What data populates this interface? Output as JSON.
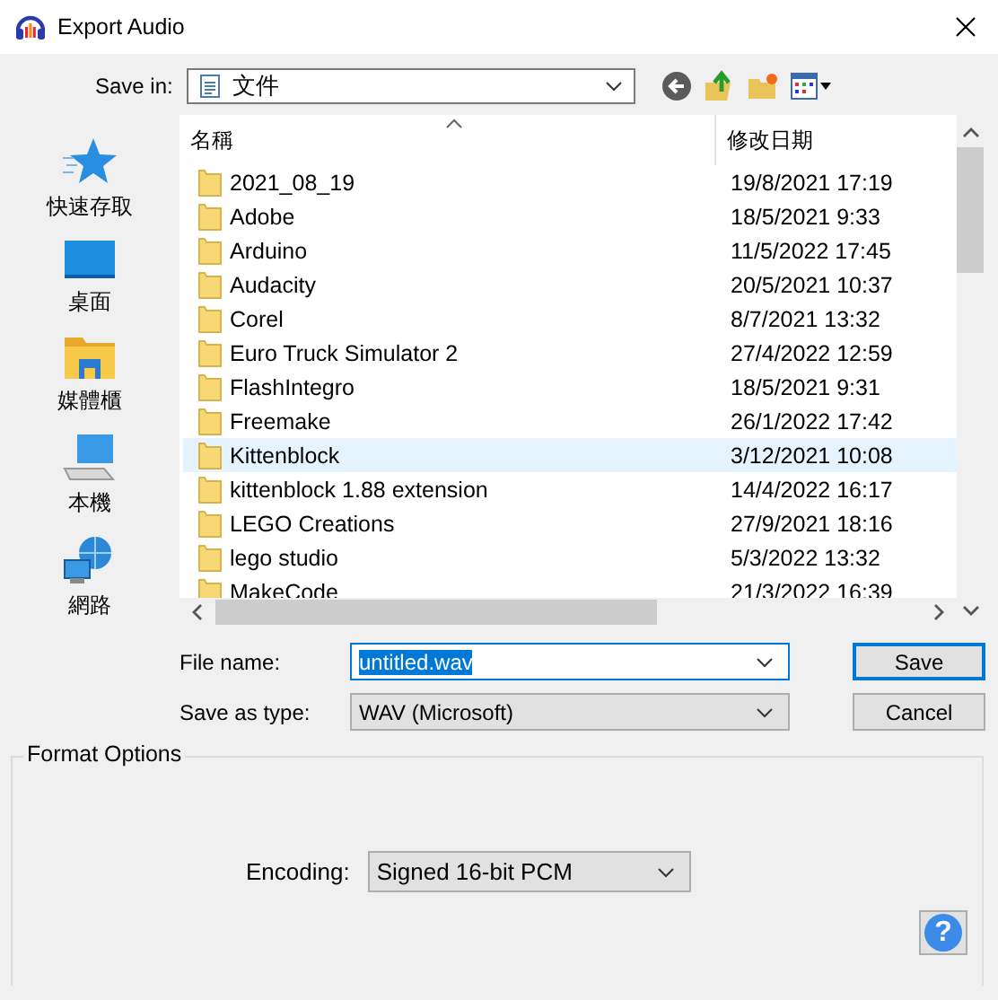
{
  "window": {
    "title": "Export Audio"
  },
  "save_in": {
    "label": "Save in:",
    "value": "文件"
  },
  "places": [
    {
      "kind": "star",
      "label": "快速存取"
    },
    {
      "kind": "desktop",
      "label": "桌面"
    },
    {
      "kind": "library",
      "label": "媒體櫃"
    },
    {
      "kind": "computer",
      "label": "本機"
    },
    {
      "kind": "network",
      "label": "網路"
    }
  ],
  "table": {
    "columns": [
      "名稱",
      "修改日期"
    ],
    "rows": [
      {
        "name": "2021_08_19",
        "date": "19/8/2021 17:19",
        "selected": false
      },
      {
        "name": "Adobe",
        "date": "18/5/2021 9:33",
        "selected": false
      },
      {
        "name": "Arduino",
        "date": "11/5/2022 17:45",
        "selected": false
      },
      {
        "name": "Audacity",
        "date": "20/5/2021 10:37",
        "selected": false
      },
      {
        "name": "Corel",
        "date": "8/7/2021 13:32",
        "selected": false
      },
      {
        "name": "Euro Truck Simulator 2",
        "date": "27/4/2022 12:59",
        "selected": false
      },
      {
        "name": "FlashIntegro",
        "date": "18/5/2021 9:31",
        "selected": false
      },
      {
        "name": "Freemake",
        "date": "26/1/2022 17:42",
        "selected": false
      },
      {
        "name": "Kittenblock",
        "date": "3/12/2021 10:08",
        "selected": true
      },
      {
        "name": "kittenblock 1.88 extension",
        "date": "14/4/2022 16:17",
        "selected": false
      },
      {
        "name": "LEGO Creations",
        "date": "27/9/2021 18:16",
        "selected": false
      },
      {
        "name": "lego studio",
        "date": "5/3/2022 13:32",
        "selected": false
      },
      {
        "name": "MakeCode",
        "date": "21/3/2022 16:39",
        "selected": false
      }
    ]
  },
  "file_name": {
    "label": "File name:",
    "value": "untitled.wav"
  },
  "save_as_type": {
    "label": "Save as type:",
    "value": "WAV (Microsoft)"
  },
  "buttons": [
    "Save",
    "Cancel"
  ],
  "format_options": {
    "title": "Format Options",
    "encoding_label": "Encoding:",
    "encoding_value": "Signed 16-bit PCM"
  },
  "help": "?"
}
